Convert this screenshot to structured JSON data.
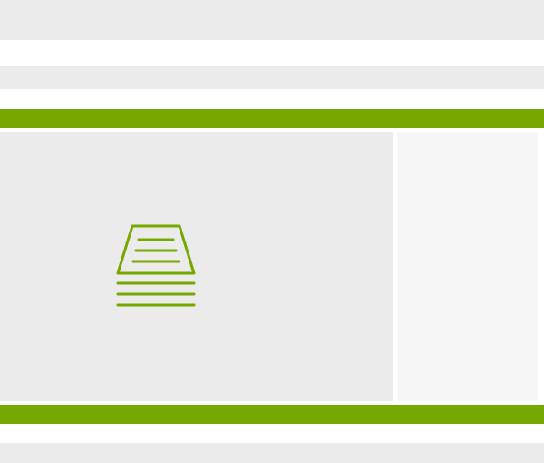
{
  "colors": {
    "accent": "#76a800",
    "placeholder_bg": "#ebebeb",
    "panel_bg": "#f7f7f7"
  },
  "icons": {
    "placeholder": "document-stack-icon"
  }
}
